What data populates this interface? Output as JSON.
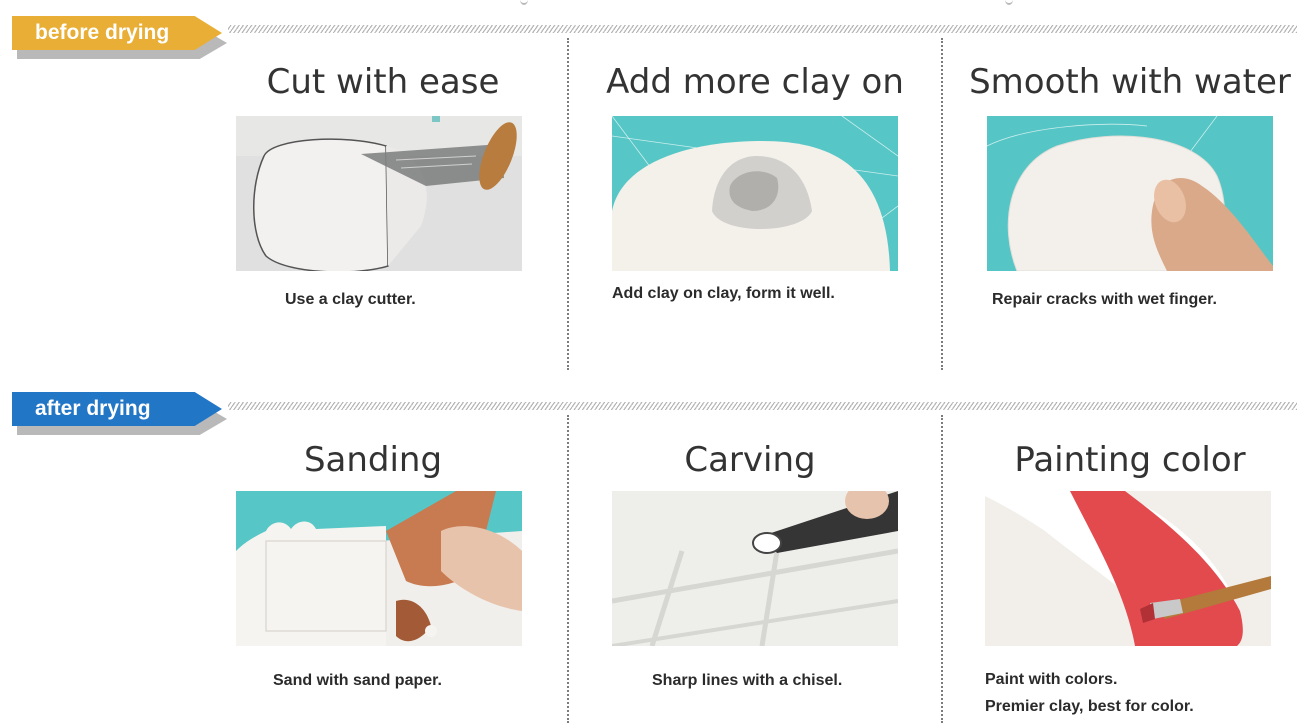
{
  "sections": {
    "before": {
      "tag": "before drying",
      "color": "#e9ae35",
      "cards": [
        {
          "title": "Cut with ease",
          "caption": "Use a clay cutter."
        },
        {
          "title": "Add more clay on",
          "caption": "Add clay on clay, form it well."
        },
        {
          "title": "Smooth with water",
          "caption": "Repair cracks with wet finger."
        }
      ]
    },
    "after": {
      "tag": "after drying",
      "color": "#2276c6",
      "cards": [
        {
          "title": "Sanding",
          "caption": "Sand with sand paper."
        },
        {
          "title": "Carving",
          "caption": "Sharp lines with a chisel."
        },
        {
          "title": "Painting color",
          "caption_lines": [
            "Paint with colors.",
            "Premier clay, best for color."
          ]
        }
      ]
    }
  }
}
